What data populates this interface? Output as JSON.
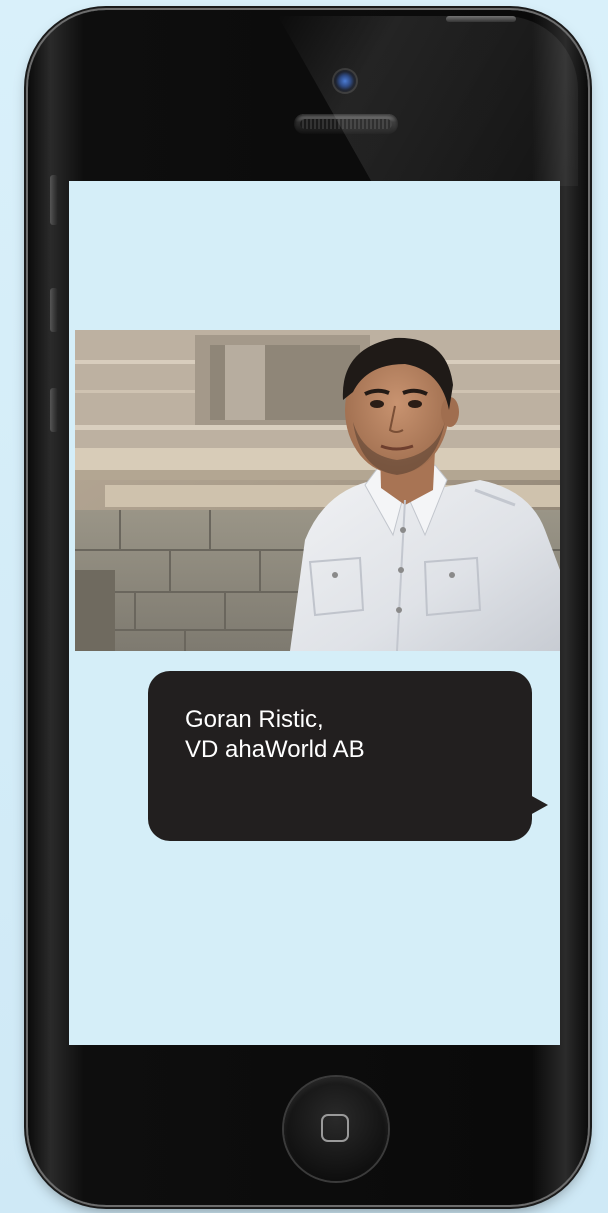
{
  "caption": {
    "name_line": "Goran Ristic,",
    "title_line": "VD ahaWorld AB"
  },
  "photo": {
    "subject": "portrait of man in white shirt in front of stone wall"
  },
  "colors": {
    "background": "#d6eef8",
    "screen": "#d5eef8",
    "phone_body": "#0e0e0e",
    "bubble": "#221f1f",
    "bubble_text": "#ffffff",
    "camera_lens": "#1b3a7a"
  },
  "icons": {
    "camera": "front-camera-icon",
    "speaker": "earpiece-speaker-icon",
    "home": "home-button-square-icon"
  }
}
